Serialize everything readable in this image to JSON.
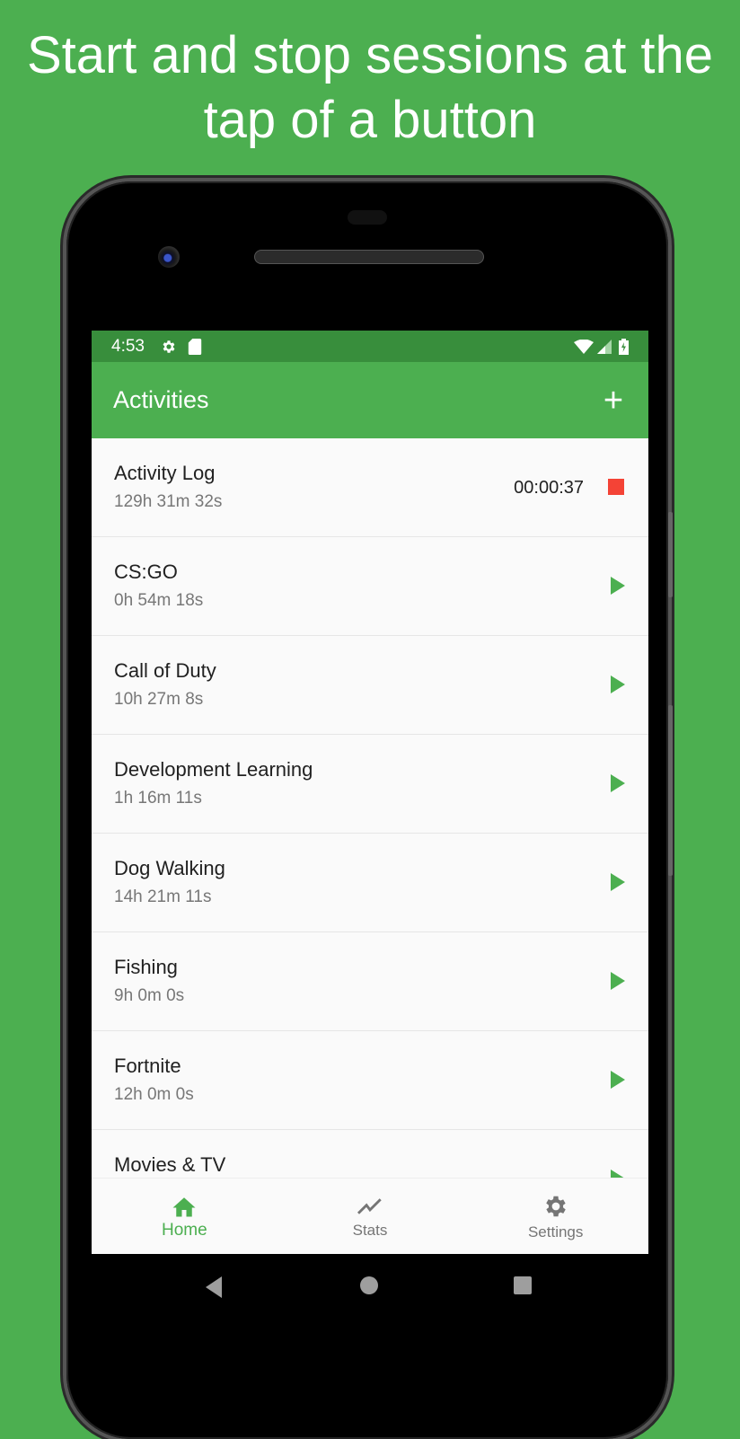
{
  "headline": "Start and stop sessions at the tap of a button",
  "status_bar": {
    "time": "4:53",
    "left_icons": [
      "gear-icon",
      "sd-card-icon"
    ],
    "right_icons": [
      "wifi-icon",
      "signal-icon",
      "battery-charging-icon"
    ]
  },
  "app_bar": {
    "title": "Activities",
    "add_label": "+"
  },
  "colors": {
    "primary": "#4caf50",
    "primary_dark": "#388e3c",
    "stop": "#f44336"
  },
  "activities": [
    {
      "name": "Activity Log",
      "total": "129h 31m 32s",
      "running": true,
      "elapsed": "00:00:37"
    },
    {
      "name": "CS:GO",
      "total": "0h 54m 18s",
      "running": false
    },
    {
      "name": "Call of Duty",
      "total": "10h 27m 8s",
      "running": false
    },
    {
      "name": "Development Learning",
      "total": "1h 16m 11s",
      "running": false
    },
    {
      "name": "Dog Walking",
      "total": "14h 21m 11s",
      "running": false
    },
    {
      "name": "Fishing",
      "total": "9h 0m 0s",
      "running": false
    },
    {
      "name": "Fortnite",
      "total": "12h 0m 0s",
      "running": false
    },
    {
      "name": "Movies & TV",
      "total": "",
      "running": false
    }
  ],
  "bottom_nav": [
    {
      "label": "Home",
      "icon": "home-icon",
      "active": true
    },
    {
      "label": "Stats",
      "icon": "stats-icon",
      "active": false
    },
    {
      "label": "Settings",
      "icon": "settings-icon",
      "active": false
    }
  ]
}
